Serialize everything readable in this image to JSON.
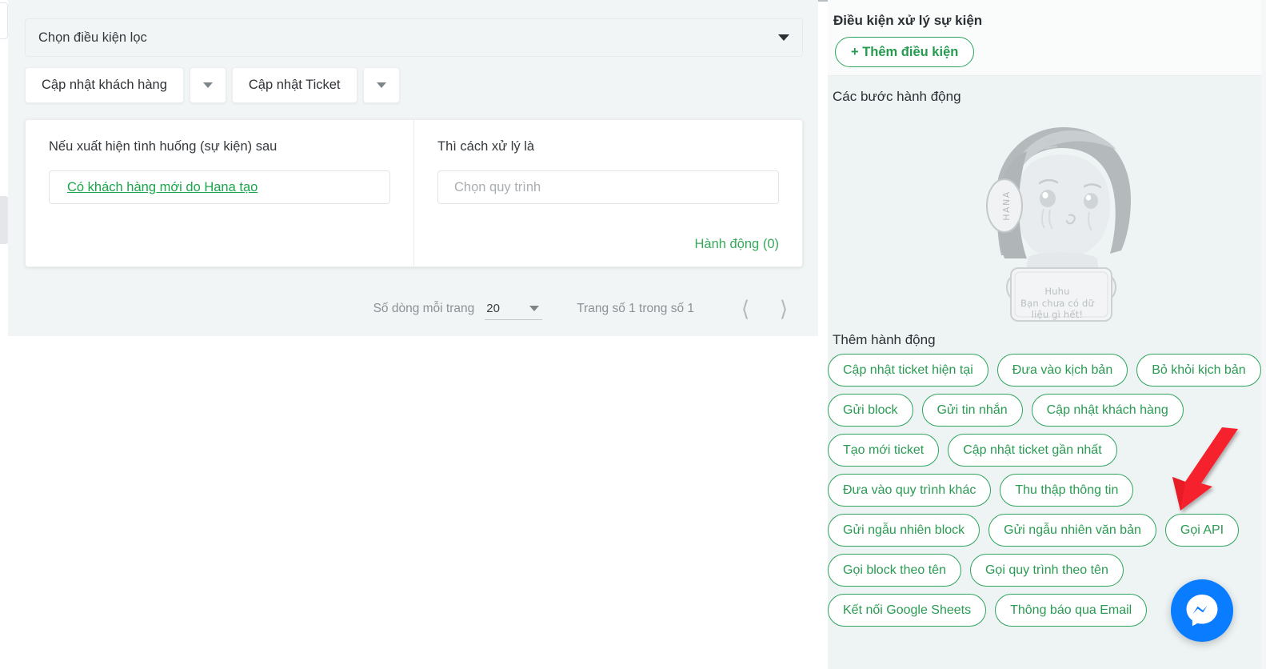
{
  "left": {
    "filter_select": {
      "label": "Chọn điều kiện lọc",
      "icon": "chevron-down-icon"
    },
    "buttons": [
      {
        "label": "Cập nhật khách hàng"
      },
      {
        "label": "Cập nhật Ticket"
      }
    ],
    "rule_card": {
      "event_column_title": "Nếu xuất hiện tình huống (sự kiện) sau",
      "event_value": "Có khách hàng mới do Hana tạo",
      "handler_column_title": "Thì cách xử lý là",
      "process_placeholder": "Chọn quy trình",
      "action_count_label": "Hành động (0)"
    },
    "pagination": {
      "rows_label": "Số dòng mỗi trang",
      "rows_value": "20",
      "page_status": "Trang số 1 trong số 1",
      "prev_icon": "chevron-left-icon",
      "next_icon": "chevron-right-icon"
    }
  },
  "right": {
    "condition_title": "Điều kiện xử lý sự kiện",
    "add_condition_label": "+ Thêm điều kiện",
    "steps_title": "Các bước hành động",
    "empty_state": {
      "caption": "Huhu\nBạn chưa có dữ liệu gì hết!",
      "caption_line1": "Huhu",
      "caption_line2": "Bạn chưa có dữ",
      "caption_line3": "liệu gì hết!",
      "headphone_brand": "HANA"
    },
    "add_action_title": "Thêm hành động",
    "action_chip_rows": [
      [
        "Cập nhật ticket hiện tại",
        "Đưa vào kịch bản",
        "Bỏ khỏi kịch bản"
      ],
      [
        "Gửi block",
        "Gửi tin nhắn",
        "Cập nhật khách hàng"
      ],
      [
        "Tạo mới ticket",
        "Cập nhật ticket gần nhất"
      ],
      [
        "Đưa vào quy trình khác",
        "Thu thập thông tin"
      ],
      [
        "Gửi ngẫu nhiên block",
        "Gửi ngẫu nhiên văn bản",
        "Gọi API"
      ],
      [
        "Gọi block theo tên",
        "Gọi quy trình theo tên"
      ],
      [
        "Kết nối Google Sheets",
        "Thông báo qua Email"
      ]
    ]
  },
  "annotation": {
    "arrow_icon": "red-arrow-pointer",
    "target_chip": "Gọi API"
  },
  "messenger": {
    "icon": "messenger-icon"
  },
  "colors": {
    "brand_green": "#2fa45d",
    "green_text": "#2b9b53",
    "link_green": "#1aa64b",
    "panel_bg": "#eef3f4",
    "left_panel_bg": "#f1f5f5",
    "messenger_blue": "#0a7cff",
    "annotation_red": "#f5222d"
  }
}
